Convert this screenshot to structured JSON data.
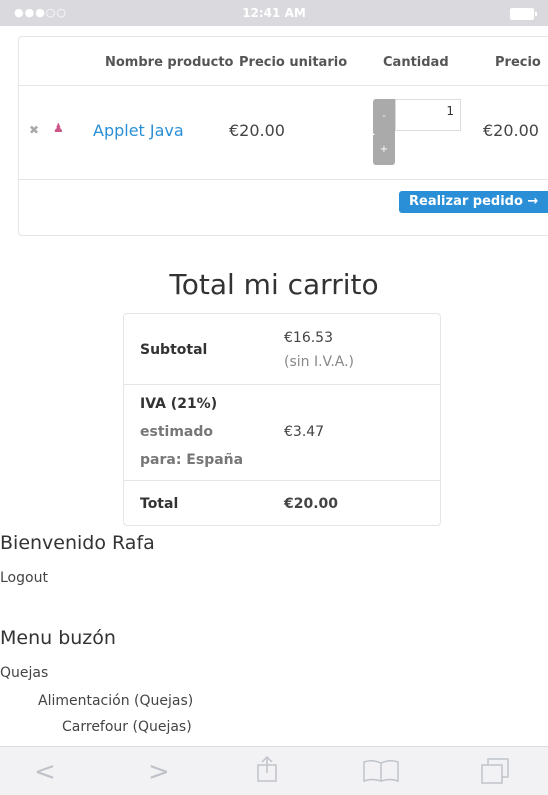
{
  "status_bar": {
    "signal": "●●●○○",
    "time": "12:41 AM"
  },
  "cart": {
    "headers": [
      "Nombre producto",
      "Precio unitario",
      "Cantidad",
      "Precio"
    ],
    "row": {
      "remove_icon": "close-icon",
      "product_name": "Applet Java",
      "unit_price": "€20.00",
      "quantity": "1",
      "minus_label": "-",
      "plus_label": "+",
      "line_total": "€20.00"
    },
    "order_button": "Realizar pedido →"
  },
  "totals": {
    "title": "Total mi carrito",
    "subtotal_label": "Subtotal",
    "subtotal_value": "€16.53",
    "subtotal_note": "(sin I.V.A.)",
    "tax_label": "IVA (21%)",
    "tax_estimated_line1": "estimado",
    "tax_estimated_line2": "para: España",
    "tax_value": "€3.47",
    "total_label": "Total",
    "total_value": "€20.00"
  },
  "user": {
    "welcome": "Bienvenido Rafa",
    "logout": "Logout"
  },
  "menu": {
    "title": "Menu buzón",
    "items": [
      {
        "label": "Quejas",
        "level": 0
      },
      {
        "label": "Alimentación (Quejas)",
        "level": 1
      },
      {
        "label": "Carrefour (Quejas)",
        "level": 2
      }
    ]
  },
  "toolbar": {
    "back": "back-icon",
    "forward": "forward-icon",
    "share": "share-icon",
    "bookmarks": "bookmarks-icon",
    "tabs": "tabs-icon"
  },
  "colors": {
    "accent": "#2a8fd6",
    "qty_buttons": "#aaaaaa"
  }
}
